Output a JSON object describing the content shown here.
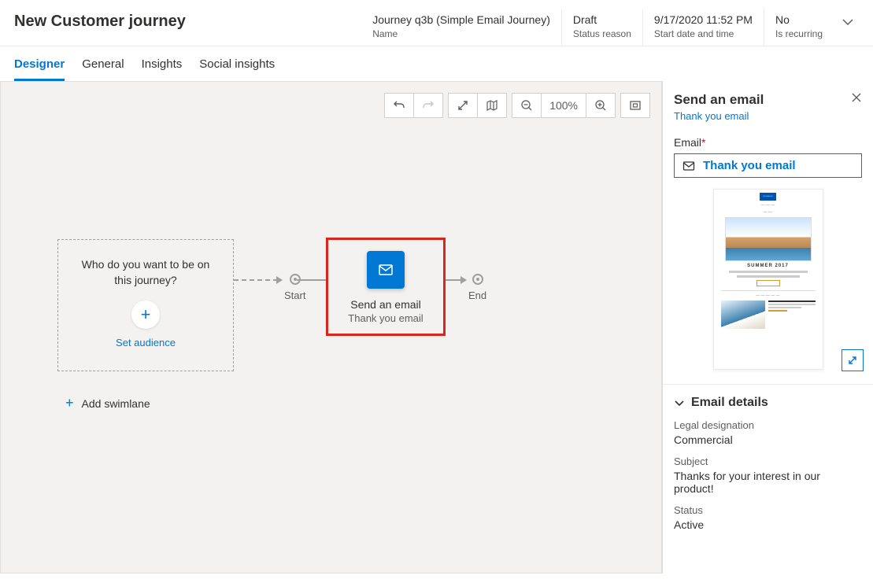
{
  "header": {
    "title": "New Customer journey",
    "meta": [
      {
        "value": "Journey q3b (Simple Email Journey)",
        "label": "Name"
      },
      {
        "value": "Draft",
        "label": "Status reason"
      },
      {
        "value": "9/17/2020 11:52 PM",
        "label": "Start date and time"
      },
      {
        "value": "No",
        "label": "Is recurring"
      }
    ]
  },
  "tabs": [
    {
      "label": "Designer",
      "active": true
    },
    {
      "label": "General",
      "active": false
    },
    {
      "label": "Insights",
      "active": false
    },
    {
      "label": "Social insights",
      "active": false
    }
  ],
  "toolbar": {
    "zoom_label": "100%"
  },
  "canvas": {
    "audience_question": "Who do you want to be on this journey?",
    "set_audience": "Set audience",
    "start_label": "Start",
    "end_label": "End",
    "email_tile": {
      "title": "Send an email",
      "subtitle": "Thank you email"
    },
    "add_swimlane": "Add swimlane"
  },
  "side_panel": {
    "title": "Send an email",
    "link": "Thank you email",
    "email_field_label": "Email",
    "email_value": "Thank you email",
    "preview_heading": "SUMMER 2017",
    "section_title": "Email details",
    "legal_label": "Legal designation",
    "legal_value": "Commercial",
    "subject_label": "Subject",
    "subject_value": "Thanks for your interest in our product!",
    "status_label": "Status",
    "status_value": "Active"
  }
}
